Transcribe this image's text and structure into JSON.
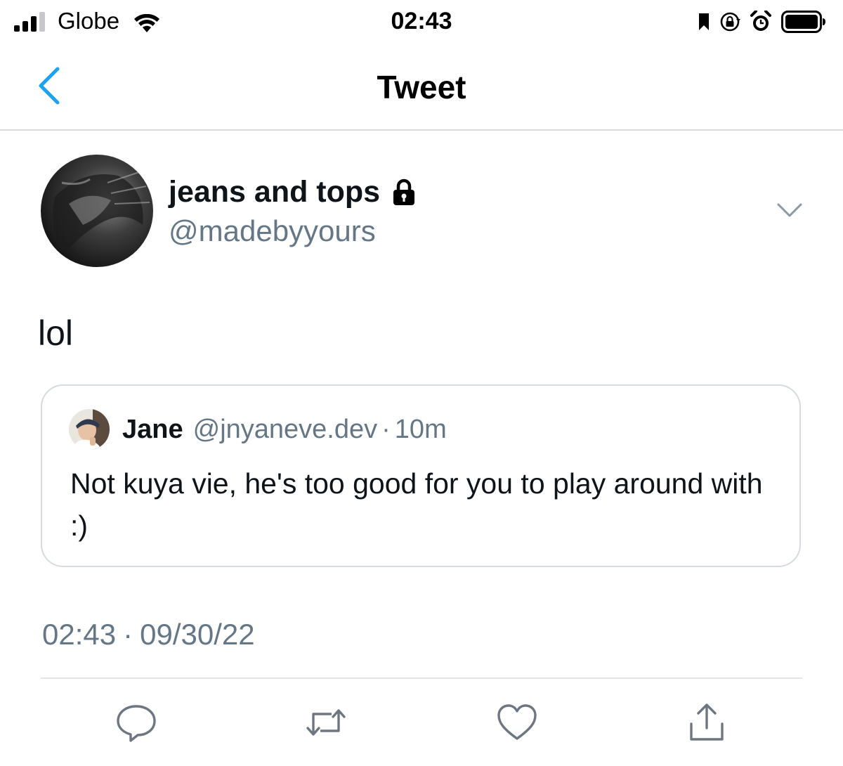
{
  "status_bar": {
    "carrier": "Globe",
    "time": "02:43"
  },
  "nav": {
    "title": "Tweet"
  },
  "tweet": {
    "author": {
      "display_name": "jeans and tops",
      "handle": "@madebyyours"
    },
    "text": "lol",
    "quoted": {
      "name": "Jane",
      "handle": "@jnyaneve.dev",
      "separator": "·",
      "time": "10m",
      "text": "Not kuya vie, he's too good for you to play around with :)"
    },
    "timestamp": {
      "time": "02:43",
      "separator": "·",
      "date": "09/30/22"
    }
  },
  "actions": [
    "reply-icon",
    "retweet-icon",
    "like-icon",
    "share-icon"
  ],
  "colors": {
    "accent": "#1da1f2",
    "secondary_text": "#657786",
    "icon_gray": "#6e7781",
    "divider": "#d8dadd"
  }
}
